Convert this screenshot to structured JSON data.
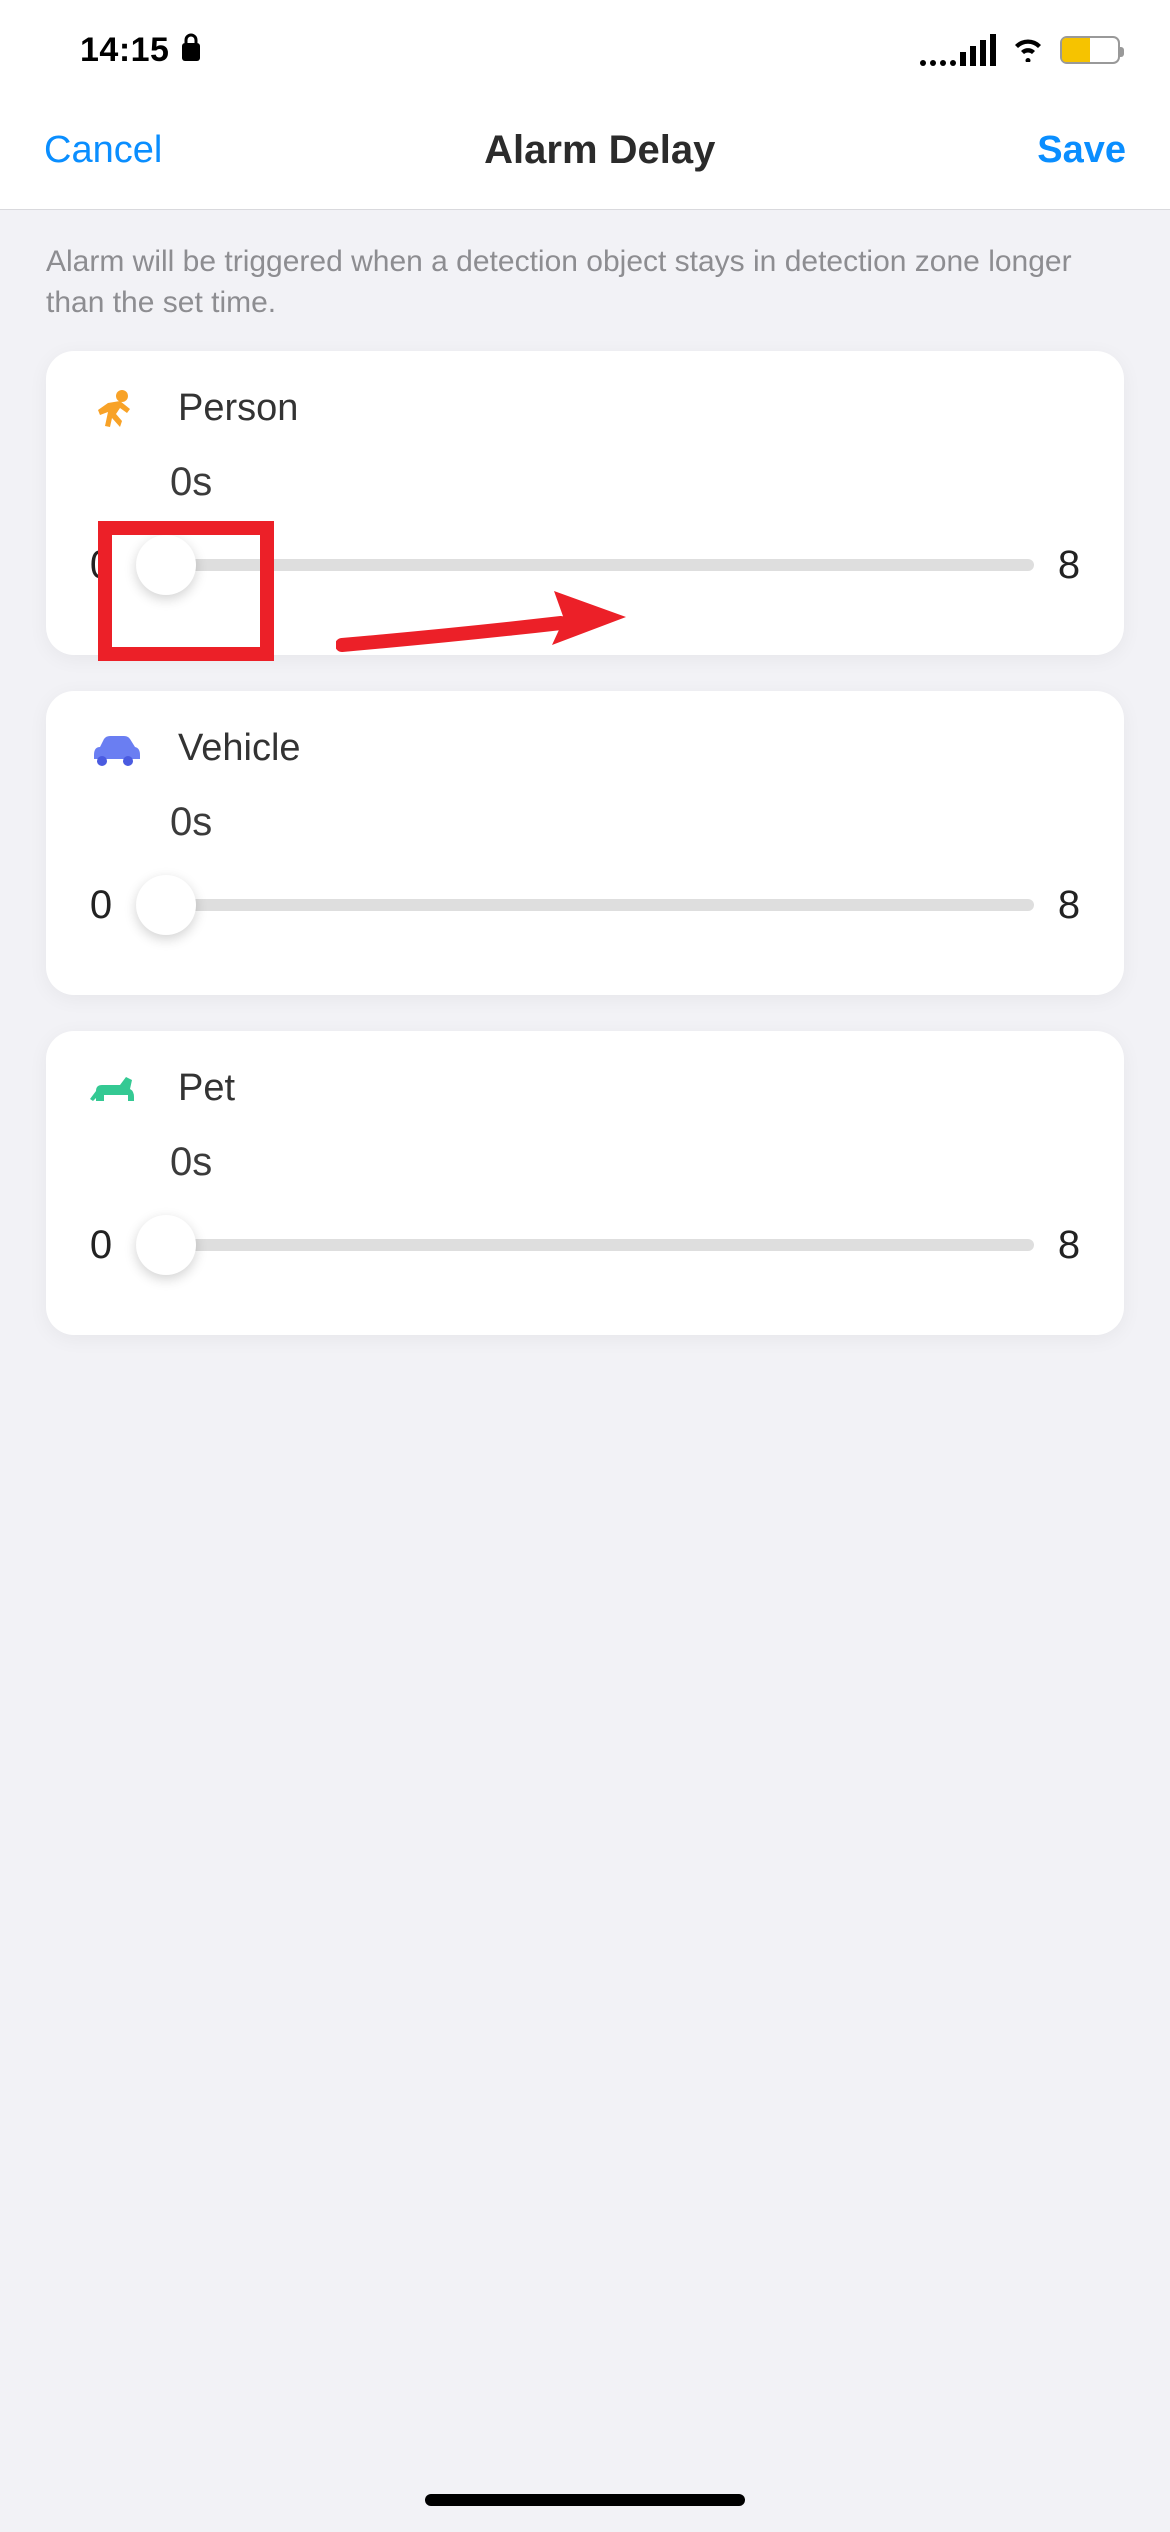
{
  "status": {
    "time": "14:15"
  },
  "nav": {
    "cancel": "Cancel",
    "title": "Alarm Delay",
    "save": "Save"
  },
  "description": "Alarm will be triggered when a detection object stays in detection zone longer than the set time.",
  "sliders": {
    "person": {
      "label": "Person",
      "value": "0s",
      "min": "0",
      "max": "8"
    },
    "vehicle": {
      "label": "Vehicle",
      "value": "0s",
      "min": "0",
      "max": "8"
    },
    "pet": {
      "label": "Pet",
      "value": "0s",
      "min": "0",
      "max": "8"
    }
  }
}
